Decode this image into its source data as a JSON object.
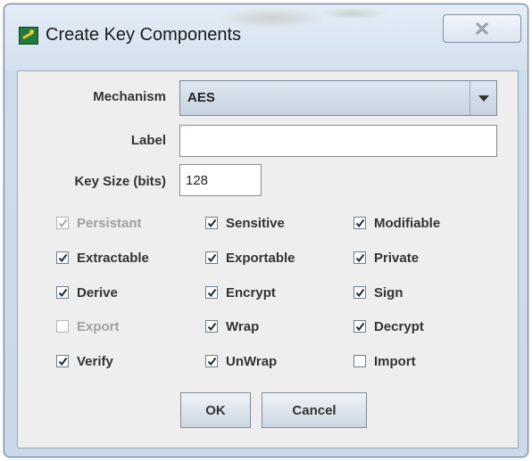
{
  "window": {
    "title": "Create Key Components"
  },
  "form": {
    "mechanism_label": "Mechanism",
    "mechanism_value": "AES",
    "label_label": "Label",
    "label_value": "",
    "keysize_label": "Key Size (bits)",
    "keysize_value": "128"
  },
  "checkboxes": [
    {
      "label": "Persistant",
      "checked": true,
      "enabled": false
    },
    {
      "label": "Sensitive",
      "checked": true,
      "enabled": true
    },
    {
      "label": "Modifiable",
      "checked": true,
      "enabled": true
    },
    {
      "label": "Extractable",
      "checked": true,
      "enabled": true
    },
    {
      "label": "Exportable",
      "checked": true,
      "enabled": true
    },
    {
      "label": "Private",
      "checked": true,
      "enabled": true
    },
    {
      "label": "Derive",
      "checked": true,
      "enabled": true
    },
    {
      "label": "Encrypt",
      "checked": true,
      "enabled": true
    },
    {
      "label": "Sign",
      "checked": true,
      "enabled": true
    },
    {
      "label": "Export",
      "checked": false,
      "enabled": false
    },
    {
      "label": "Wrap",
      "checked": true,
      "enabled": true
    },
    {
      "label": "Decrypt",
      "checked": true,
      "enabled": true
    },
    {
      "label": "Verify",
      "checked": true,
      "enabled": true
    },
    {
      "label": "UnWrap",
      "checked": true,
      "enabled": true
    },
    {
      "label": "Import",
      "checked": false,
      "enabled": true
    }
  ],
  "buttons": {
    "ok_label": "OK",
    "cancel_label": "Cancel"
  },
  "icons": {
    "app": "key-app-icon",
    "close": "close-icon",
    "dropdown": "chevron-down-icon",
    "check": "check-icon"
  }
}
